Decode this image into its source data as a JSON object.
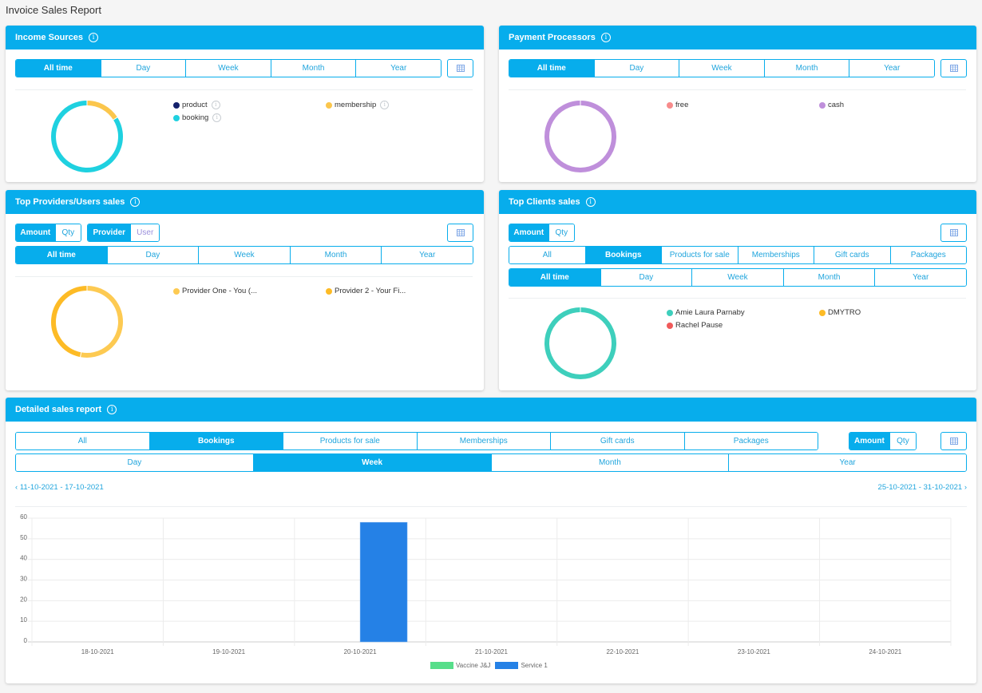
{
  "page": {
    "title": "Invoice Sales Report"
  },
  "common": {
    "info_glyph": "i",
    "period_options": [
      "All time",
      "Day",
      "Week",
      "Month",
      "Year"
    ],
    "type_options": [
      "All",
      "Bookings",
      "Products for sale",
      "Memberships",
      "Gift cards",
      "Packages"
    ],
    "measure_options": [
      "Amount",
      "Qty"
    ],
    "role_options": [
      "Provider",
      "User"
    ]
  },
  "income_sources": {
    "title": "Income Sources",
    "selected_period": "All time",
    "legend": [
      {
        "label": "product",
        "color": "#14216b",
        "value": 0
      },
      {
        "label": "membership",
        "color": "#fbc64c",
        "value": 16
      },
      {
        "label": "booking",
        "color": "#1fd1e0",
        "value": 84
      }
    ]
  },
  "payment_processors": {
    "title": "Payment Processors",
    "selected_period": "All time",
    "legend": [
      {
        "label": "free",
        "color": "#f78b8b",
        "value": 0
      },
      {
        "label": "cash",
        "color": "#bf8fdb",
        "value": 100
      }
    ]
  },
  "top_providers": {
    "title": "Top Providers/Users sales",
    "selected_measure": "Amount",
    "selected_role": "Provider",
    "selected_period": "All time",
    "legend": [
      {
        "label": "Provider One - You (...",
        "color": "#fdca52",
        "value": 53
      },
      {
        "label": "Provider 2 - Your Fi...",
        "color": "#fdbb26",
        "value": 47
      }
    ]
  },
  "top_clients": {
    "title": "Top Clients sales",
    "selected_measure": "Amount",
    "selected_type": "Bookings",
    "selected_period": "All time",
    "legend": [
      {
        "label": "Amie Laura Parnaby",
        "color": "#3ecfbc",
        "value": 100
      },
      {
        "label": "DMYTRO",
        "color": "#fdbb26",
        "value": 0
      },
      {
        "label": "Rachel Pause",
        "color": "#f05a5a",
        "value": 0
      }
    ]
  },
  "detailed_report": {
    "title": "Detailed sales report",
    "selected_type": "Bookings",
    "selected_measure": "Amount",
    "granularity_options": [
      "Day",
      "Week",
      "Month",
      "Year"
    ],
    "selected_granularity": "Week",
    "prev_range": "11-10-2021 - 17-10-2021",
    "next_range": "25-10-2021 - 31-10-2021",
    "prev_arrow": "‹",
    "next_arrow": "›"
  },
  "chart_data": {
    "type": "bar",
    "title": "",
    "xlabel": "",
    "ylabel": "",
    "categories": [
      "18-10-2021",
      "19-10-2021",
      "20-10-2021",
      "21-10-2021",
      "22-10-2021",
      "23-10-2021",
      "24-10-2021"
    ],
    "series": [
      {
        "name": "Vaccine J&J",
        "color": "#57de8a",
        "values": [
          0,
          0,
          0,
          0,
          0,
          0,
          0
        ]
      },
      {
        "name": "Service 1",
        "color": "#2581e6",
        "values": [
          0,
          0,
          58,
          0,
          0,
          0,
          0
        ]
      }
    ],
    "yticks": [
      0,
      10,
      20,
      30,
      40,
      50,
      60
    ],
    "ylim": [
      0,
      60
    ],
    "grid": true,
    "legend_position": "bottom-center"
  }
}
